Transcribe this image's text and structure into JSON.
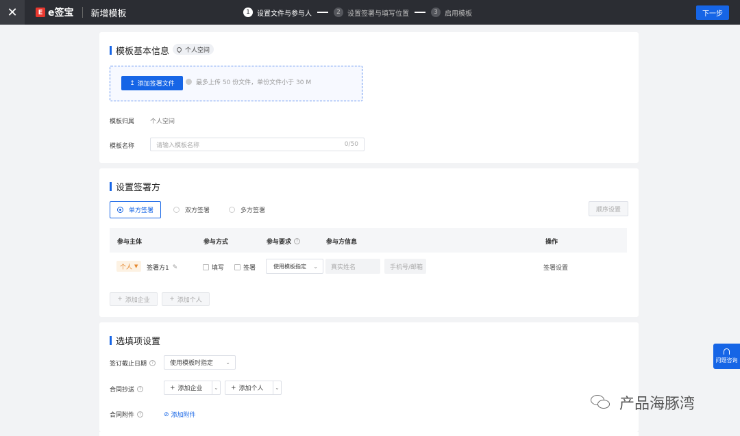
{
  "topbar": {
    "close_glyph": "✕",
    "logo_mark": "E",
    "logo_text": "e签宝",
    "page_title": "新增模板",
    "steps": [
      {
        "num": "1",
        "label": "设置文件与参与人",
        "state": "active"
      },
      {
        "num": "2",
        "label": "设置签署与填写位置",
        "state": "inactive"
      },
      {
        "num": "3",
        "label": "启用模板",
        "state": "inactive"
      }
    ],
    "next_label": "下一步",
    "accent": "#1665e6"
  },
  "basic": {
    "title": "模板基本信息",
    "space_tag": "个人空间",
    "upload_label": "添加签署文件",
    "upload_icon": "↥",
    "upload_hint": "最多上传 50 份文件，单份文件小于 30 M",
    "owner_label": "模板归属",
    "owner_value": "个人空间",
    "name_label": "模板名称",
    "name_placeholder": "请输入模板名称",
    "name_count": "0/50"
  },
  "signers": {
    "title": "设置签署方",
    "modes": [
      "单方签署",
      "双方签署",
      "多方签署"
    ],
    "selected_mode": "单方签署",
    "order_button": "顺序设置",
    "columns": [
      "参与主体",
      "参与方式",
      "参与要求",
      "参与方信息",
      "操作"
    ],
    "row": {
      "type_tag": "个人",
      "name": "签署方1",
      "fill_label": "填写",
      "sign_label": "签署",
      "requirement": "使用模板指定",
      "name_placeholder": "真实姓名",
      "contact_placeholder": "手机号/邮箱",
      "action": "签署设置"
    },
    "add_company": "添加企业",
    "add_person": "添加个人"
  },
  "options": {
    "title": "选填项设置",
    "deadline_label": "签订截止日期",
    "deadline_value": "使用模板时指定",
    "cc_label": "合同抄送",
    "cc_company": "添加企业",
    "cc_person": "添加个人",
    "attach_label": "合同附件",
    "attach_link": "添加附件"
  },
  "help_float": "问题咨询",
  "watermark": "产品海豚湾"
}
